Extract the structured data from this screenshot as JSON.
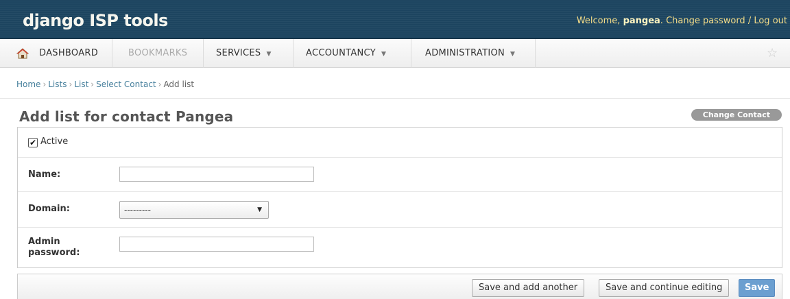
{
  "header": {
    "branding": "django ISP tools",
    "welcome": "Welcome, ",
    "username": "pangea",
    "after_user": ". ",
    "change_password": "Change password",
    "slash": " / ",
    "logout": "Log out"
  },
  "nav": {
    "dashboard": "DASHBOARD",
    "bookmarks": "BOOKMARKS",
    "services": "SERVICES",
    "accountancy": "ACCOUNTANCY",
    "administration": "ADMINISTRATION",
    "caret": "▼",
    "star": "☆"
  },
  "breadcrumbs": {
    "home": "Home",
    "lists": "Lists",
    "list": "List",
    "select_contact": "Select Contact",
    "current": "Add list",
    "sep": "›"
  },
  "page": {
    "title": "Add list for contact Pangea",
    "change_contact": "Change Contact"
  },
  "form": {
    "active_label": "Active",
    "active_checked": "✔",
    "name_label": "Name:",
    "name_value": "",
    "domain_label": "Domain:",
    "domain_selected": "---------",
    "admin_password_label_1": "Admin",
    "admin_password_label_2": "password:",
    "admin_password_value": ""
  },
  "submit": {
    "save_add_another": "Save and add another",
    "save_continue": "Save and continue editing",
    "save": "Save"
  },
  "colors": {
    "header_bg": "#1d4560",
    "user_tools": "#f5dd88",
    "link": "#447e9b",
    "save_button": "#6b9fd0"
  }
}
